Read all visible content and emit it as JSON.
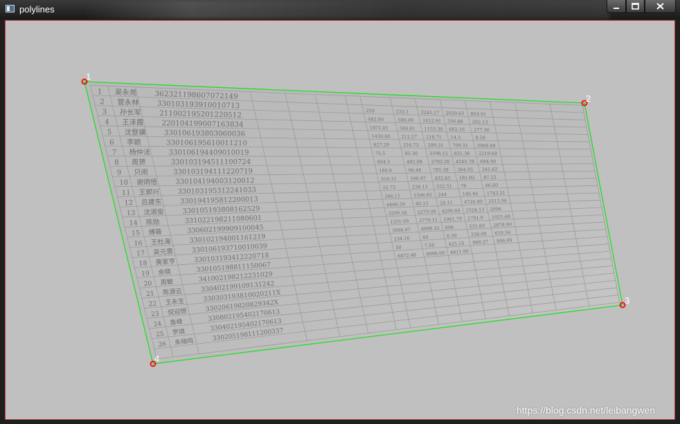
{
  "window": {
    "title": "polylines",
    "controls": [
      "minimize",
      "maximize",
      "close"
    ]
  },
  "polyline": {
    "color": "#22dd22",
    "marker_color": "#ee1111",
    "points": [
      "1",
      "2",
      "3",
      "4"
    ]
  },
  "document": {
    "rows": [
      {
        "no": "1",
        "name": "吴永亮",
        "id": "362321198607072149"
      },
      {
        "no": "2",
        "name": "管永林",
        "id": "330103193910010713"
      },
      {
        "no": "3",
        "name": "孙长军",
        "id": "211002195201220512"
      },
      {
        "no": "4",
        "name": "王泽霞",
        "id": "220104199007163834"
      },
      {
        "no": "5",
        "name": "沈登骥",
        "id": "330106193803060036"
      },
      {
        "no": "6",
        "name": "李颖",
        "id": "330106195610011210"
      },
      {
        "no": "7",
        "name": "杨仲法",
        "id": "330106194409010019"
      },
      {
        "no": "8",
        "name": "周赟",
        "id": "330103194511100724"
      },
      {
        "no": "9",
        "name": "只闹",
        "id": "330103194111220719"
      },
      {
        "no": "10",
        "name": "谢炳悟",
        "id": "330104194003120012"
      },
      {
        "no": "11",
        "name": "王郭兴",
        "id": "330103195312241033"
      },
      {
        "no": "12",
        "name": "吕建东",
        "id": "330194195812200013"
      },
      {
        "no": "13",
        "name": "沈淑俊",
        "id": "330105193808162529"
      },
      {
        "no": "14",
        "name": "陈勋",
        "id": "331022198211080601"
      },
      {
        "no": "15",
        "name": "傅薇",
        "id": "330602199909100045"
      },
      {
        "no": "16",
        "name": "王杜海",
        "id": "330102194001161219"
      },
      {
        "no": "17",
        "name": "吴元惠",
        "id": "330106193710010039"
      },
      {
        "no": "18",
        "name": "黄家亨",
        "id": "330103193412220718"
      },
      {
        "no": "19",
        "name": "余晓",
        "id": "330105198811150067"
      },
      {
        "no": "20",
        "name": "周敏",
        "id": "341002198212231029"
      },
      {
        "no": "21",
        "name": "陈源云",
        "id": "330402199109131242"
      },
      {
        "no": "22",
        "name": "王永生",
        "id": "330303193810020211X"
      },
      {
        "no": "23",
        "name": "倪迎想",
        "id": "33020619820829342X"
      },
      {
        "no": "24",
        "name": "詹峰",
        "id": "330802195402170613"
      },
      {
        "no": "25",
        "name": "罗琪",
        "id": "330402195402170613"
      },
      {
        "no": "26",
        "name": "朱晓鸣",
        "id": "330205198111200337"
      }
    ],
    "extra_values": [
      "259",
      "233.1",
      "2245.17",
      "2020.65",
      "804.91",
      "482.90",
      "506.09",
      "1612.91",
      "336.88",
      "292.13",
      "1871.01",
      "346.01",
      "1153.30",
      "602.16",
      "277.30",
      "1430.60",
      "212.27",
      "218.71",
      "14.5",
      "8.58",
      "827.29",
      "216.73",
      "299.31",
      "709.31",
      "3060.66",
      "75.5",
      "85.30",
      "3196.15",
      "821.36",
      "2219.68",
      "804.3",
      "482.08",
      "2782.26",
      "4245.78",
      "684.90",
      "160.6",
      "96.48",
      "781.38",
      "264.05",
      "241.62",
      "316.11",
      "190.97",
      "432.45",
      "181.82",
      "87.22",
      "52.72",
      "234.13",
      "552.51",
      "76",
      "46.60",
      "346.11",
      "1596.81",
      "244",
      "146.46",
      "1743.21",
      "4406.59",
      "40.13",
      "24.11",
      "4726.80",
      "2513.96",
      "3299.34",
      "2279.09",
      "4290.60",
      "1524.13",
      "2096",
      "1251.09",
      "2779.11",
      "1961.79",
      "1791.9",
      "1025.68",
      "3906.87",
      "4998.32",
      "896",
      "531.60",
      "2878.90",
      "234.16",
      "60",
      "6.30",
      "256.00",
      "618.56",
      "50",
      "7.50",
      "425.15",
      "968.27",
      "906.09",
      "6872.48",
      "8996.00",
      "4811.90"
    ]
  },
  "watermark": "https://blog.csdn.net/leibangwen"
}
